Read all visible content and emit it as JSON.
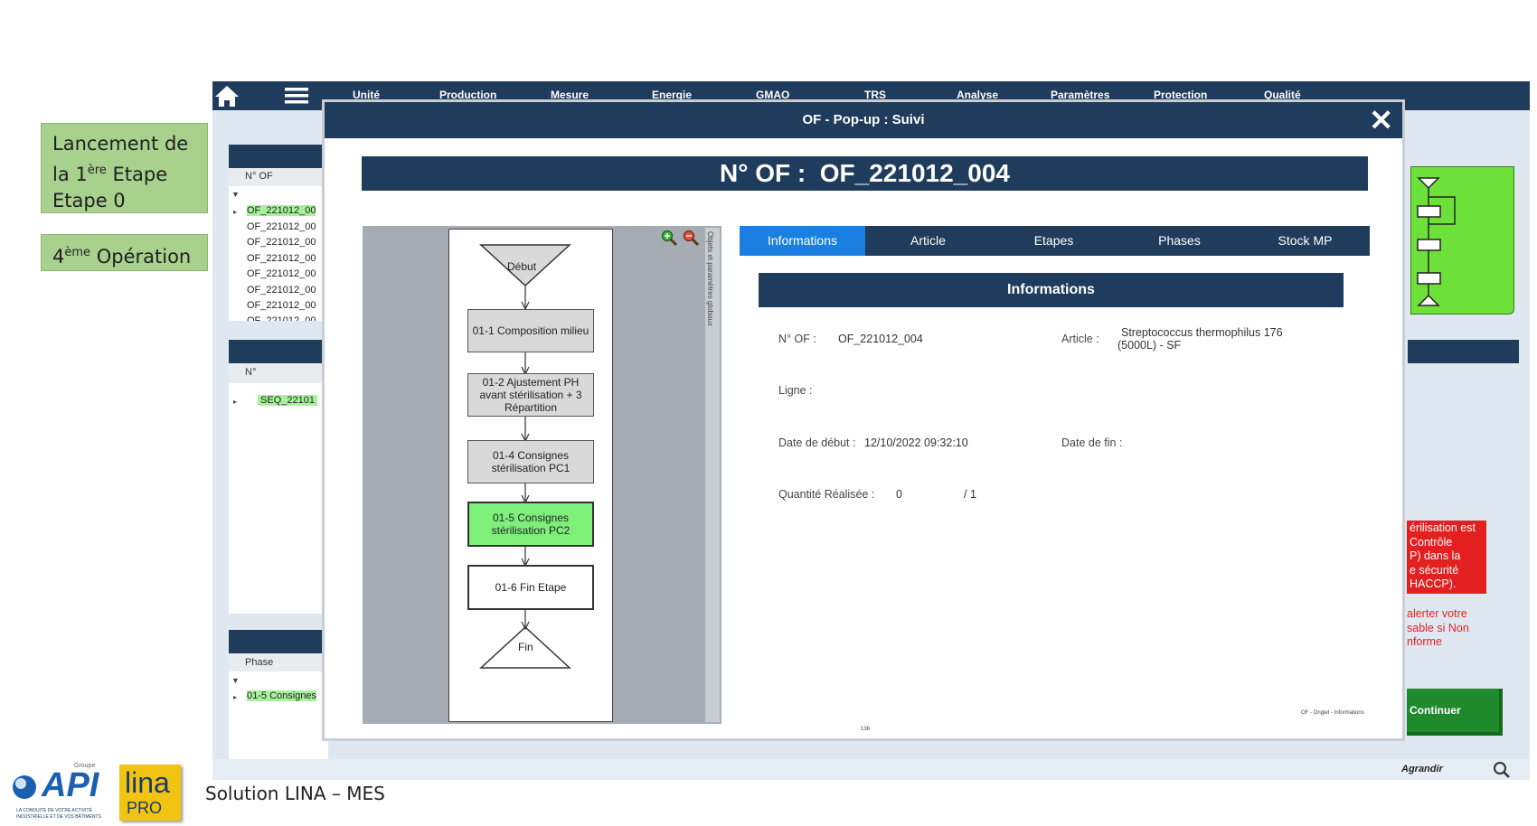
{
  "annotations": {
    "launch_line1": "Lancement de",
    "launch_line2_prefix": "la 1",
    "launch_line2_sup": "ère",
    "launch_line2_suffix": " Etape",
    "launch_line3": "Etape 0",
    "operation_prefix": "4",
    "operation_sup": "ème",
    "operation_suffix": " Opération"
  },
  "nav": {
    "items": [
      "Unité",
      "Production",
      "Mesure",
      "Energie",
      "GMAO",
      "TRS",
      "Analyse",
      "Paramètres",
      "Protection",
      "Qualité"
    ]
  },
  "bg_panels": {
    "of_header": "N° OF",
    "of_rows": [
      "OF_221012_00",
      "OF_221012_00",
      "OF_221012_00",
      "OF_221012_00",
      "OF_221012_00",
      "OF_221012_00",
      "OF_221012_00",
      "OF_221012_00"
    ],
    "seq_header": "N°",
    "seq_row": "SEQ_22101",
    "phase_header": "Phase",
    "phase_row": "01-5 Consignes"
  },
  "popup": {
    "title": "OF - Pop-up : Suivi",
    "banner_label": "N° OF :",
    "banner_value": "OF_221012_004",
    "diagram": {
      "side_label": "Objets et paramètres globaux",
      "start": "Début",
      "end": "Fin",
      "steps": [
        {
          "label": "01-1 Composition milieu",
          "state": "gray"
        },
        {
          "label": "01-2 Ajustement PH avant stérilisation + 3 Répartition",
          "state": "gray"
        },
        {
          "label": "01-4 Consignes stérilisation PC1",
          "state": "gray"
        },
        {
          "label": "01-5 Consignes stérilisation PC2",
          "state": "active"
        },
        {
          "label": "01-6 Fin Etape",
          "state": "white"
        }
      ]
    },
    "tabs": [
      "Informations",
      "Article",
      "Etapes",
      "Phases",
      "Stock MP"
    ],
    "active_tab": "Informations",
    "info": {
      "header": "Informations",
      "of_label": "N° OF :",
      "of_value": "OF_221012_004",
      "article_label": "Article :",
      "article_value_line1": "Streptococcus thermophilus 176",
      "article_value_line2": "(5000L) - SF",
      "ligne_label": "Ligne :",
      "date_start_label": "Date de début :",
      "date_start_value": "12/10/2022 09:32:10",
      "date_end_label": "Date de fin :",
      "qty_label": "Quantité Réalisée :",
      "qty_value": "0",
      "qty_total": "/ 1",
      "footer_note": "OF - Onglet - Informations",
      "page_num": "136"
    }
  },
  "right_bg": {
    "red_box_lines": [
      "érilisation est",
      "Contrôle",
      "P) dans la",
      "e sécurité",
      "HACCP)."
    ],
    "red_text_lines": [
      "alerter votre",
      "sable si Non",
      "nforme"
    ],
    "continue_label": "Continuer",
    "agrandir_label": "Agrandir"
  },
  "footer": {
    "title": "Solution LINA – MES",
    "api_brand": "API",
    "api_group": "Groupe",
    "api_tagline1": "LA CONDUITE DE VOTRE ACTIVITÉ",
    "api_tagline2": "INDUSTRIELLE ET DE VOS BÂTIMENTS",
    "lina_brand": "lina",
    "lina_sub": "PRO"
  },
  "colors": {
    "navy": "#1f3c5c",
    "active_tab": "#1a7fe0",
    "active_step": "#7ef07a",
    "callout": "#a9d18e",
    "alert_red": "#e32020",
    "continue_green": "#1f8a2c"
  }
}
